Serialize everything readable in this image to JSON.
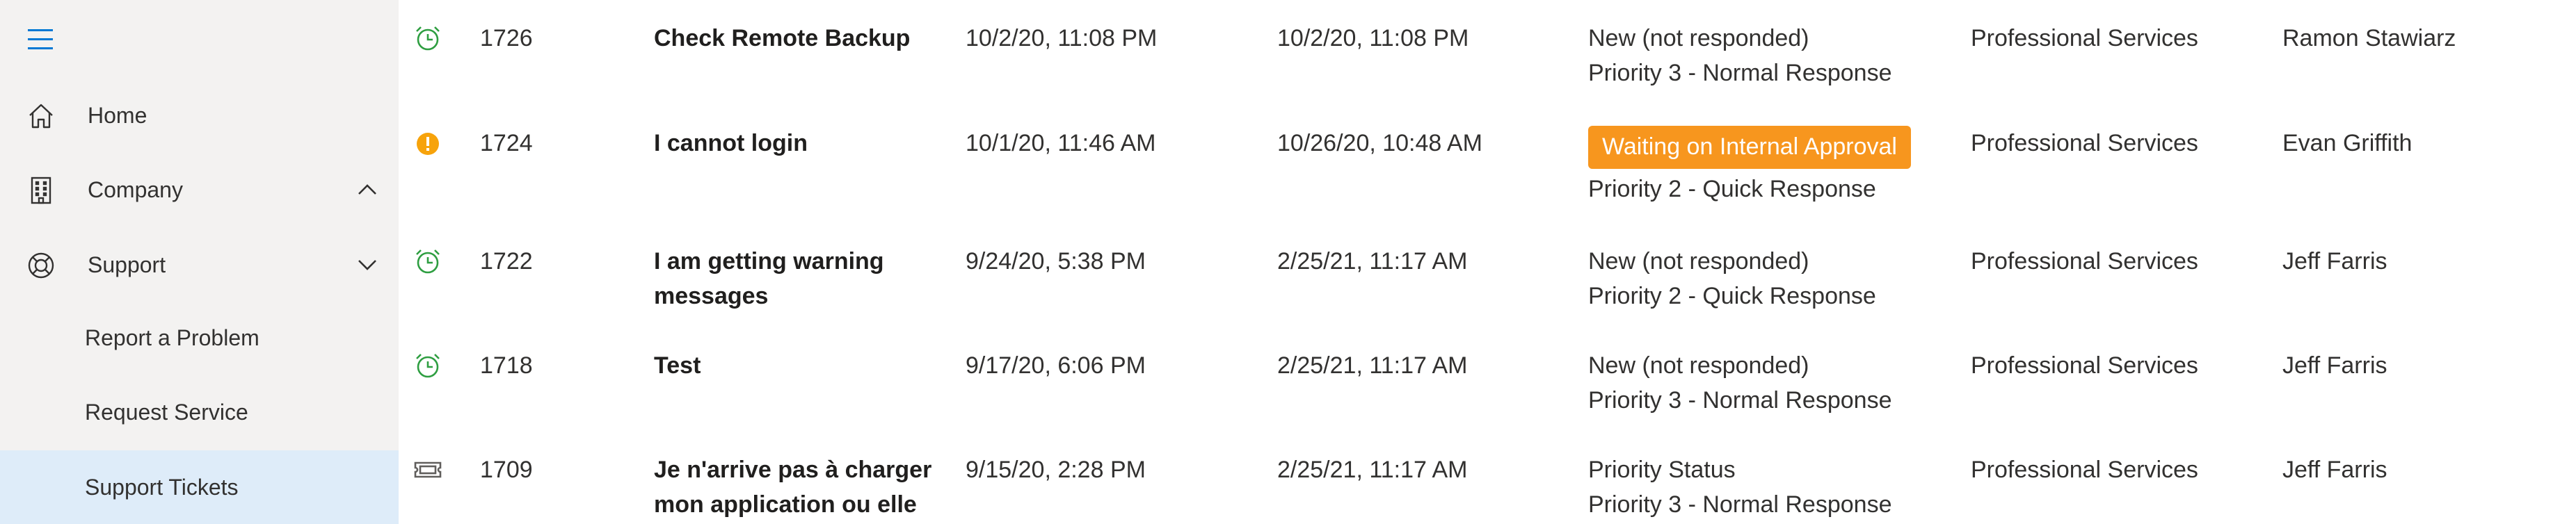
{
  "sidebar": {
    "items": [
      {
        "label": "Home",
        "icon": "home-icon"
      },
      {
        "label": "Company",
        "icon": "building-icon",
        "chevron": "up"
      },
      {
        "label": "Support",
        "icon": "lifebuoy-icon",
        "chevron": "down"
      }
    ],
    "sub_items": [
      {
        "label": "Report a Problem"
      },
      {
        "label": "Request Service"
      },
      {
        "label": "Support Tickets",
        "selected": true
      }
    ]
  },
  "tickets": [
    {
      "icon": "alarm-clock-icon",
      "id": "1726",
      "title": "Check Remote Backup",
      "created": "10/2/20, 11:08 PM",
      "updated": "10/2/20, 11:08 PM",
      "status": "New (not responded)",
      "priority": "Priority 3 - Normal Response",
      "department": "Professional Services",
      "owner": "Ramon Stawiarz"
    },
    {
      "icon": "warning-circle-icon",
      "id": "1724",
      "title": "I cannot login",
      "created": "10/1/20, 11:46 AM",
      "updated": "10/26/20, 10:48 AM",
      "status": "Waiting on Internal Approval",
      "priority": "Priority 2 - Quick Response",
      "department": "Professional Services",
      "owner": "Evan Griffith"
    },
    {
      "icon": "alarm-clock-icon",
      "id": "1722",
      "title": "I am getting warning messages",
      "created": "9/24/20, 5:38 PM",
      "updated": "2/25/21, 11:17 AM",
      "status": "New (not responded)",
      "priority": "Priority 2 - Quick Response",
      "department": "Professional Services",
      "owner": "Jeff Farris"
    },
    {
      "icon": "alarm-clock-icon",
      "id": "1718",
      "title": "Test",
      "created": "9/17/20, 6:06 PM",
      "updated": "2/25/21, 11:17 AM",
      "status": "New (not responded)",
      "priority": "Priority 3 - Normal Response",
      "department": "Professional Services",
      "owner": "Jeff Farris"
    },
    {
      "icon": "ticket-icon",
      "id": "1709",
      "title": "Je n'arrive pas à charger mon application ou elle",
      "created": "9/15/20, 2:28 PM",
      "updated": "2/25/21, 11:17 AM",
      "status": "Priority Status",
      "priority": "Priority 3 - Normal Response",
      "department": "Professional Services",
      "owner": "Jeff Farris"
    }
  ],
  "colors": {
    "accent": "#0078d4",
    "sidebar_bg": "#f3f2f1",
    "selected_bg": "#deecf9",
    "badge": "#f7961e",
    "alarm_green": "#2e9e41",
    "warning_orange": "#f7a30b"
  }
}
